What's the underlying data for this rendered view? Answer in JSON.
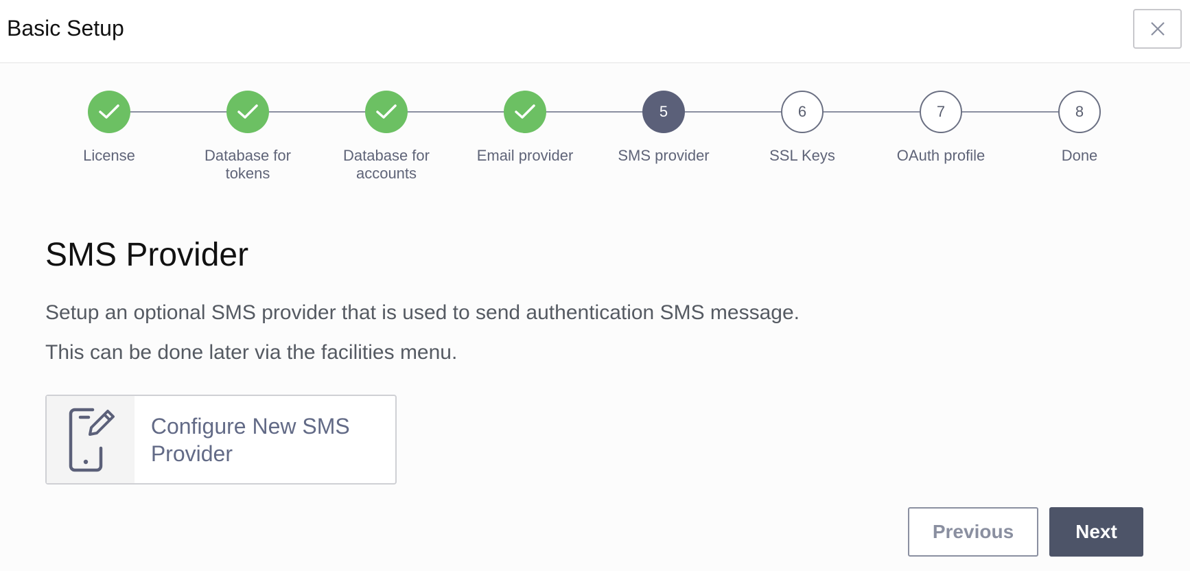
{
  "header": {
    "title": "Basic Setup",
    "close_icon": "close-icon"
  },
  "steps": [
    {
      "label": "License",
      "status": "done"
    },
    {
      "label": "Database for tokens",
      "status": "done"
    },
    {
      "label": "Database for accounts",
      "status": "done"
    },
    {
      "label": "Email provider",
      "status": "done"
    },
    {
      "label": "SMS provider",
      "status": "current",
      "number": "5"
    },
    {
      "label": "SSL Keys",
      "status": "pending",
      "number": "6"
    },
    {
      "label": "OAuth profile",
      "status": "pending",
      "number": "7"
    },
    {
      "label": "Done",
      "status": "pending",
      "number": "8"
    }
  ],
  "main": {
    "title": "SMS Provider",
    "description_1": "Setup an optional SMS provider that is used to send authentication SMS message.",
    "description_2": "This can be done later via the facilities menu.",
    "config_card": {
      "label": "Configure New SMS Provider",
      "icon": "phone-edit-icon"
    }
  },
  "footer": {
    "previous_label": "Previous",
    "next_label": "Next"
  },
  "colors": {
    "done": "#6cc063",
    "current": "#5b6079",
    "primary_button": "#4d5468"
  }
}
